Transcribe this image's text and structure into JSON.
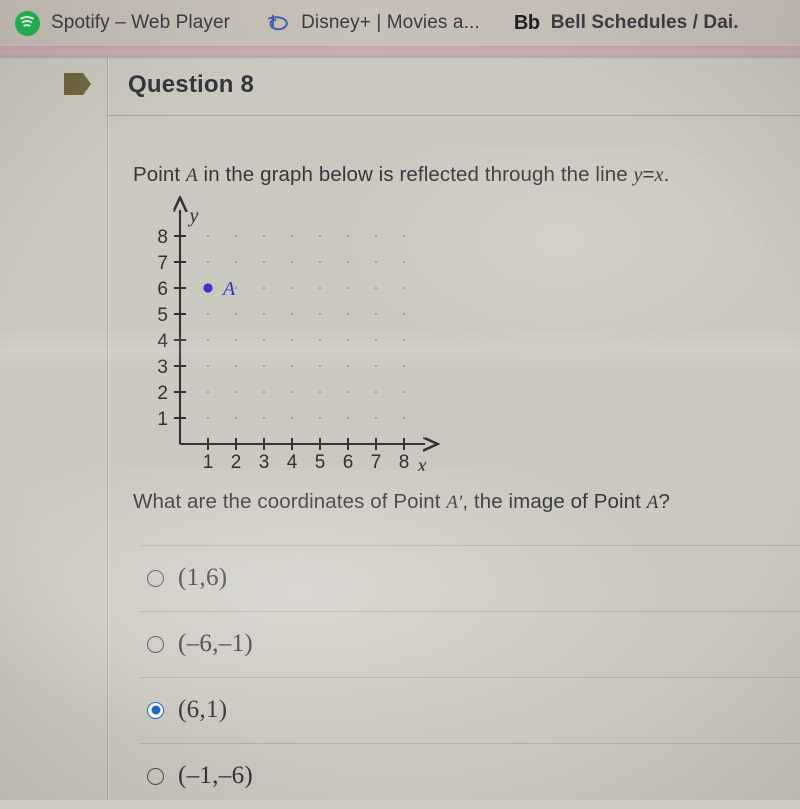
{
  "browser": {
    "tabs": [
      {
        "title": "Spotify – Web Player",
        "icon": "spotify-icon",
        "bold": false
      },
      {
        "title": "Disney+ | Movies a...",
        "icon": "disney-plus-icon",
        "bold": false
      },
      {
        "title": "Bell Schedules / Dai.",
        "icon": "blackboard-bb-icon",
        "bold": true
      }
    ]
  },
  "question": {
    "header_title": "Question 8",
    "flag_icon": "flag-bookmark-icon",
    "prompt_before_var": "Point ",
    "prompt_var_a": "A",
    "prompt_after_var": " in the graph below is reflected through the line ",
    "prompt_line_y": "y",
    "prompt_line_eq": "=",
    "prompt_line_x": "x",
    "prompt_period": ".",
    "question_before_var": "What are the coordinates of Point ",
    "question_var_aprime": "A′",
    "question_middle": ", the image of Point ",
    "question_var_a": "A",
    "question_end": "?"
  },
  "graph": {
    "x_axis_label": "x",
    "y_axis_label": "y",
    "x_ticks": [
      "1",
      "2",
      "3",
      "4",
      "5",
      "6",
      "7",
      "8"
    ],
    "y_ticks": [
      "1",
      "2",
      "3",
      "4",
      "5",
      "6",
      "7",
      "8"
    ],
    "point_label": "A",
    "point_x": 1,
    "point_y": 6,
    "point_color": "#3333cc",
    "grid_style": "dot-lattice"
  },
  "options": [
    {
      "label": "(1,6)",
      "selected": false
    },
    {
      "label": "(–6,–1)",
      "selected": false
    },
    {
      "label": "(6,1)",
      "selected": true
    },
    {
      "label": "(–1,–6)",
      "selected": false
    }
  ],
  "colors": {
    "accent": "#1563c8",
    "page_bg": "#cdcac1",
    "tabstrip_bg": "#cdc6bd",
    "pink_band": "#c4a8ae",
    "text": "#35353b",
    "spotify_green": "#1db954",
    "disney_blue": "#3b5bb5"
  }
}
